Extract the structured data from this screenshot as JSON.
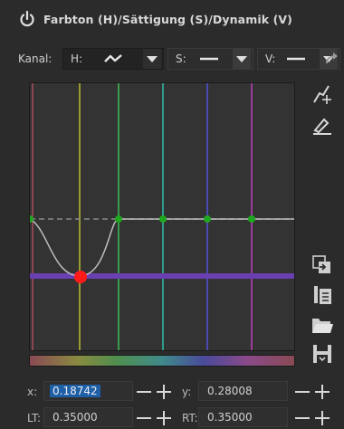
{
  "header": {
    "title": "Farbton (H)/Sättigung (S)/Dynamik (V)",
    "power_icon": "power-icon"
  },
  "channels": {
    "label": "Kanal:",
    "items": [
      {
        "label": "H:",
        "icon": "curve-icon",
        "active": true
      },
      {
        "label": "S:",
        "icon": "flat-line-icon",
        "active": false
      },
      {
        "label": "V:",
        "icon": "flat-line-icon",
        "active": false
      }
    ]
  },
  "curve": {
    "x": [
      "x:",
      "0.18742"
    ],
    "y": [
      "y:",
      "0.28008"
    ],
    "lt": [
      "LT:",
      "0.35000"
    ],
    "rt": [
      "RT:",
      "0.35000"
    ]
  },
  "tools": [
    "edit-points-icon",
    "picker-icon",
    "copy-icon",
    "paste-icon",
    "open-icon",
    "save-icon"
  ],
  "colors": {
    "background": "#2b2b2b",
    "panel": "#333333",
    "control_point": "#1fa81f",
    "selected_point": "#ff1a1a",
    "selection_line": "#6a3fb0",
    "curve": "#bdbdbd"
  }
}
